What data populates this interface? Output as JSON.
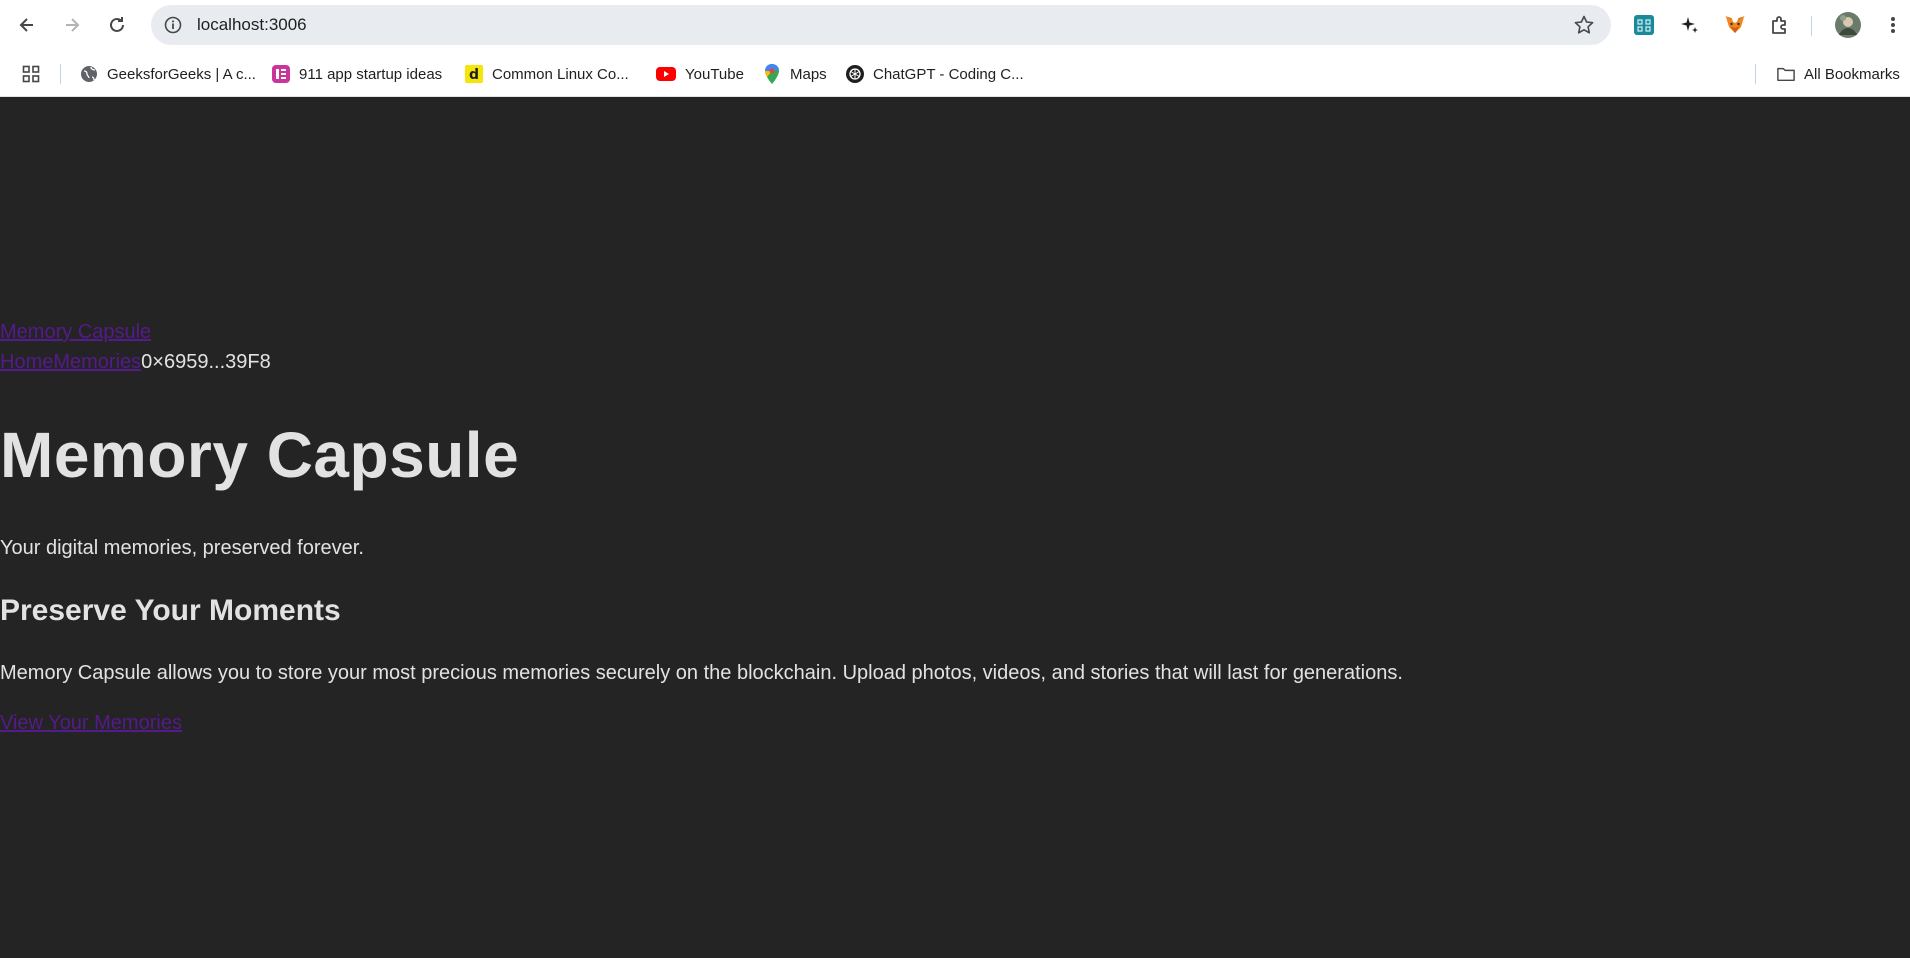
{
  "browser": {
    "url": "localhost:3006",
    "bookmarks": [
      {
        "label": "GeeksforGeeks | A c...",
        "icon": "globe-icon"
      },
      {
        "label": "911 app startup ideas",
        "icon": "app-icon"
      },
      {
        "label": "Common Linux Co...",
        "icon": "d-icon"
      },
      {
        "label": "YouTube",
        "icon": "youtube-icon"
      },
      {
        "label": "Maps",
        "icon": "maps-icon"
      },
      {
        "label": "ChatGPT - Coding C...",
        "icon": "chatgpt-icon"
      }
    ],
    "all_bookmarks_label": "All Bookmarks"
  },
  "page": {
    "brand_link": "Memory Capsule",
    "nav": {
      "home": "Home",
      "memories": "Memories",
      "wallet_address": "0×6959...39F8"
    },
    "hero_title": "Memory Capsule",
    "tagline": "Your digital memories, preserved forever.",
    "section_title": "Preserve Your Moments",
    "description": "Memory Capsule allows you to store your most precious memories securely on the blockchain. Upload photos, videos, and stories that will last for generations.",
    "cta_link": "View Your Memories"
  },
  "colors": {
    "page_background": "#242424",
    "link": "#551a8b",
    "text": "#e8e8e8"
  }
}
